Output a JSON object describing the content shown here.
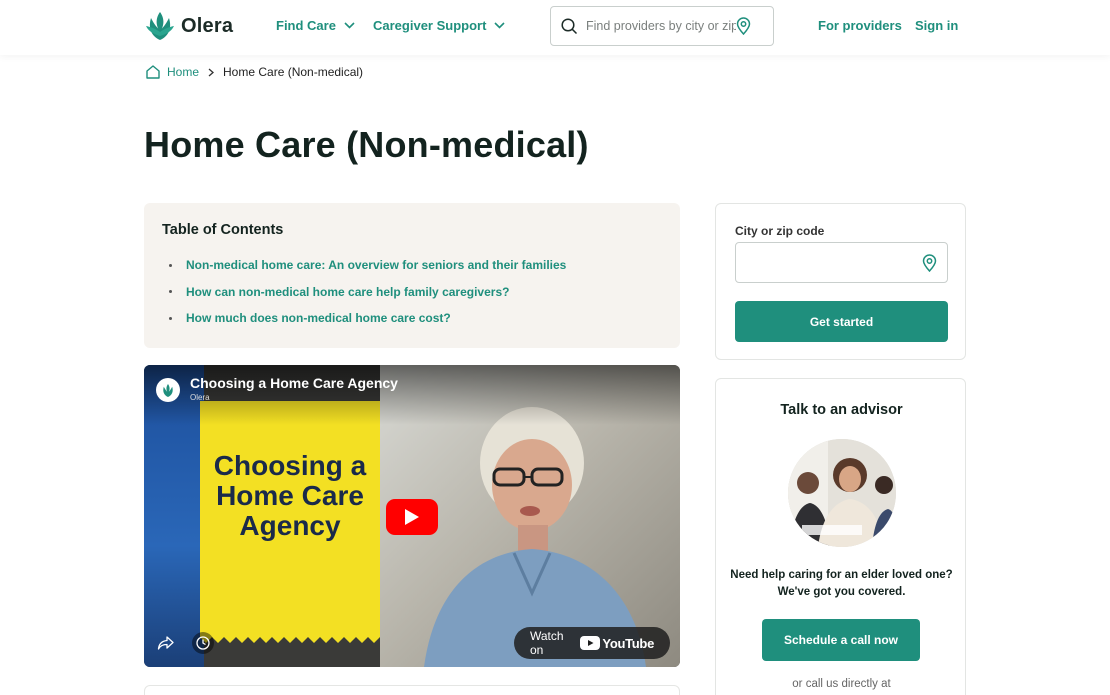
{
  "header": {
    "logo_text": "Olera",
    "nav": [
      {
        "label": "Find Care"
      },
      {
        "label": "Caregiver Support"
      }
    ],
    "search": {
      "placeholder": "Find providers by city or zip"
    },
    "for_providers": "For providers",
    "sign_in": "Sign in"
  },
  "breadcrumb": {
    "home": "Home",
    "current": "Home Care (Non-medical)"
  },
  "page": {
    "title": "Home Care (Non-medical)"
  },
  "toc": {
    "title": "Table of Contents",
    "items": [
      {
        "label": "Non-medical home care: An overview for seniors and their families"
      },
      {
        "label": "How can non-medical home care help family caregivers?"
      },
      {
        "label": "How much does non-medical home care cost?"
      }
    ]
  },
  "video": {
    "title": "Choosing a Home Care Agency",
    "channel": "Olera",
    "thumbnail_line1": "Choosing a",
    "thumbnail_line2": "Home Care",
    "thumbnail_line3": "Agency",
    "watch_on": "Watch on",
    "youtube": "YouTube"
  },
  "location_card": {
    "label": "City or zip code",
    "value": "",
    "button": "Get started"
  },
  "advisor_card": {
    "title": "Talk to an advisor",
    "text": "Need help caring for an elder loved one? We've got you covered.",
    "button": "Schedule a call now",
    "footer": "or call us directly at"
  },
  "colors": {
    "brand": "#1f8f7d",
    "toc_bg": "#f6f3ef",
    "youtube_red": "#ff0000",
    "thumbnail_yellow": "#f3e023"
  },
  "icons": [
    "leaf-logo-icon",
    "chevron-down-icon",
    "search-icon",
    "location-pin-icon",
    "home-icon",
    "chevron-right-icon",
    "play-icon",
    "share-icon",
    "clock-icon"
  ]
}
